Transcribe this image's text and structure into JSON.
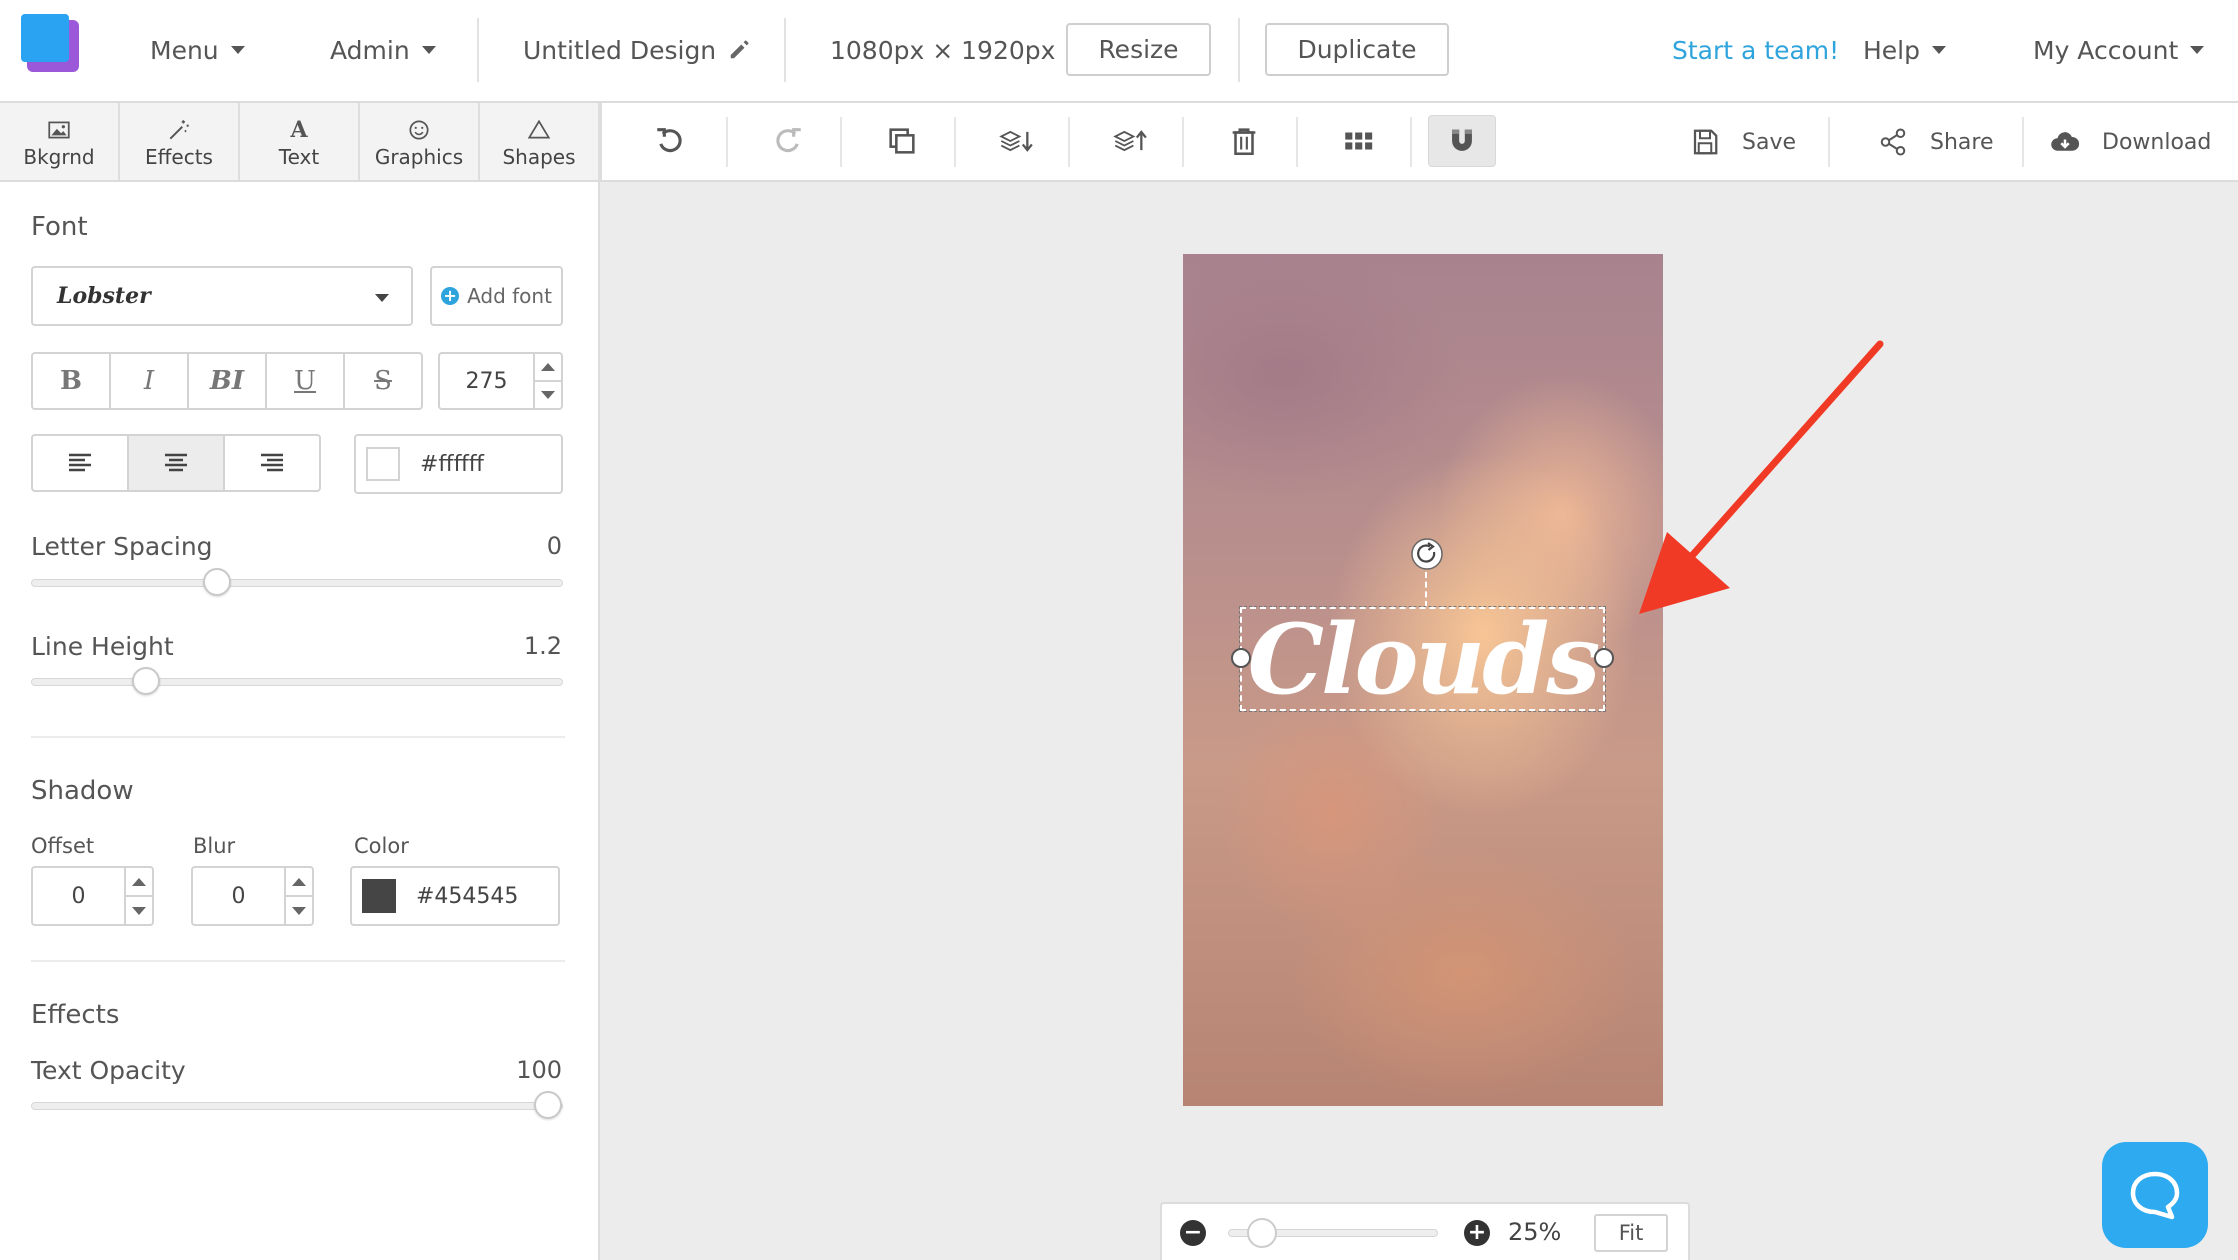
{
  "nav": {
    "menu": "Menu",
    "admin": "Admin",
    "design_title": "Untitled Design",
    "dimensions": "1080px × 1920px",
    "resize": "Resize",
    "duplicate": "Duplicate",
    "start_team": "Start a team!",
    "help": "Help",
    "my_account": "My Account"
  },
  "tabs": [
    {
      "label": "Bkgrnd",
      "icon": "image-icon"
    },
    {
      "label": "Effects",
      "icon": "magic-wand-icon"
    },
    {
      "label": "Text",
      "icon": "text-icon"
    },
    {
      "label": "Graphics",
      "icon": "smiley-icon"
    },
    {
      "label": "Shapes",
      "icon": "triangle-icon"
    }
  ],
  "toolbar": {
    "save": "Save",
    "share": "Share",
    "download": "Download"
  },
  "panel": {
    "font_title": "Font",
    "font_name": "Lobster",
    "add_font": "Add font",
    "bold": "B",
    "italic": "I",
    "bold_italic": "BI",
    "underline": "U",
    "strike": "S",
    "font_size": "275",
    "text_color": "#ffffff",
    "letter_spacing_label": "Letter Spacing",
    "letter_spacing_value": "0",
    "letter_spacing_fraction": 0.34,
    "line_height_label": "Line Height",
    "line_height_value": "1.2",
    "line_height_fraction": 0.2,
    "shadow_title": "Shadow",
    "offset_label": "Offset",
    "offset_value": "0",
    "blur_label": "Blur",
    "blur_value": "0",
    "shadow_color_label": "Color",
    "shadow_color": "#454545",
    "effects_title": "Effects",
    "opacity_label": "Text Opacity",
    "opacity_value": "100",
    "opacity_fraction": 1.0
  },
  "canvas": {
    "text": "Clouds",
    "zoom": "25%",
    "fit": "Fit",
    "zoom_fraction": 0.1
  },
  "colors": {
    "accent": "#2fa4dc",
    "arrow": "#f03a25",
    "chat": "#2eaaf0"
  }
}
